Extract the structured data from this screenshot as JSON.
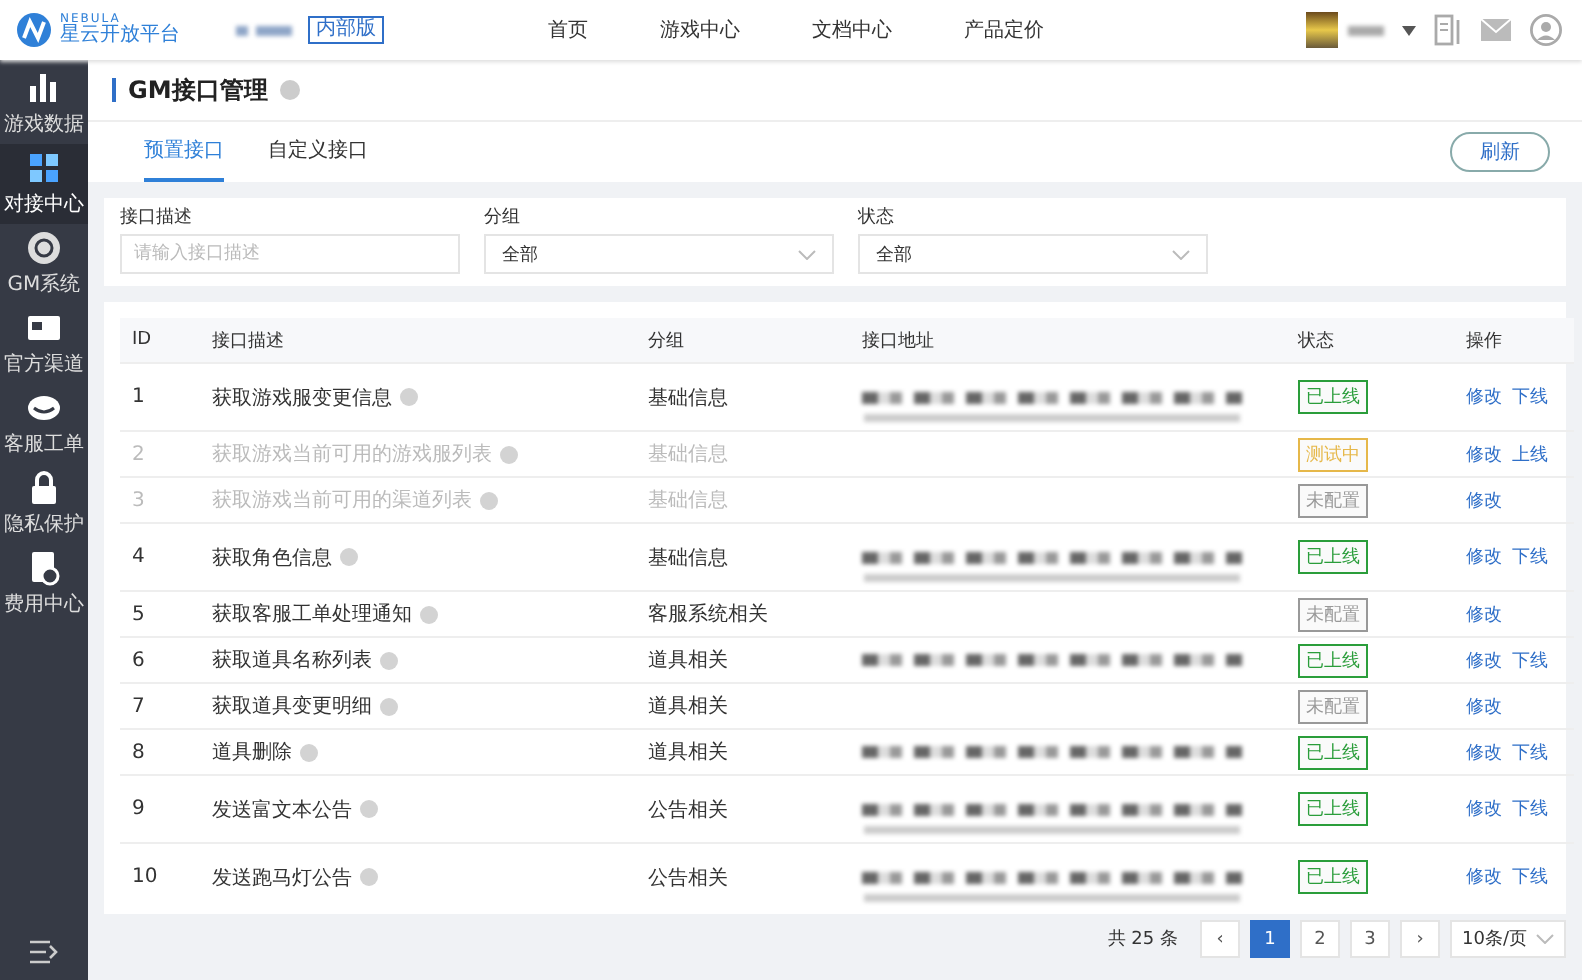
{
  "topbar": {
    "logo_word": "NEBULA",
    "logo_name": "星云开放平台",
    "edition_badge": "内部版",
    "nav": [
      {
        "label": "首页",
        "selected": false
      },
      {
        "label": "游戏中心",
        "selected": false
      },
      {
        "label": "文档中心",
        "selected": false
      },
      {
        "label": "产品定价",
        "selected": false
      }
    ]
  },
  "sidebar": {
    "items": [
      {
        "label": "游戏数据",
        "selected": false
      },
      {
        "label": "对接中心",
        "selected": true
      },
      {
        "label": "GM系统",
        "selected": false
      },
      {
        "label": "官方渠道",
        "selected": false
      },
      {
        "label": "客服工单",
        "selected": false
      },
      {
        "label": "隐私保护",
        "selected": false
      },
      {
        "label": "费用中心",
        "selected": false
      }
    ]
  },
  "page": {
    "title": "GM接口管理",
    "tabs": [
      {
        "label": "预置接口",
        "selected": true
      },
      {
        "label": "自定义接口",
        "selected": false
      }
    ],
    "refresh_button": "刷新"
  },
  "filters": [
    {
      "label": "接口描述",
      "kind": "input",
      "placeholder": "请输入接口描述"
    },
    {
      "label": "分组",
      "kind": "select",
      "value": "全部"
    },
    {
      "label": "状态",
      "kind": "select",
      "value": "全部"
    }
  ],
  "table": {
    "columns": [
      "ID",
      "接口描述",
      "分组",
      "接口地址",
      "状态",
      "操作"
    ],
    "rows": [
      {
        "kind": "long-address",
        "id": "1",
        "description": "获取游戏服变更信息",
        "group": "基础信息",
        "status": {
          "label": "已上线",
          "color": "#2a9d3a"
        },
        "disabled": false,
        "actions": [
          "修改",
          "下线"
        ]
      },
      {
        "kind": "no-address",
        "id": "2",
        "description": "获取游戏当前可用的游戏服列表",
        "group": "基础信息",
        "status": {
          "label": "测试中",
          "color": "#e6b84a"
        },
        "disabled": true,
        "actions": [
          "修改",
          "上线"
        ]
      },
      {
        "kind": "no-address",
        "id": "3",
        "description": "获取游戏当前可用的渠道列表",
        "group": "基础信息",
        "status": {
          "label": "未配置",
          "color": "#999999"
        },
        "disabled": true,
        "actions": [
          "修改"
        ]
      },
      {
        "kind": "long-address",
        "id": "4",
        "description": "获取角色信息",
        "group": "基础信息",
        "status": {
          "label": "已上线",
          "color": "#2a9d3a"
        },
        "disabled": false,
        "actions": [
          "修改",
          "下线"
        ]
      },
      {
        "kind": "no-address",
        "id": "5",
        "description": "获取客服工单处理通知",
        "group": "客服系统相关",
        "status": {
          "label": "未配置",
          "color": "#999999"
        },
        "disabled": false,
        "actions": [
          "修改"
        ]
      },
      {
        "kind": "short-address",
        "id": "6",
        "description": "获取道具名称列表",
        "group": "道具相关",
        "status": {
          "label": "已上线",
          "color": "#2a9d3a"
        },
        "disabled": false,
        "actions": [
          "修改",
          "下线"
        ]
      },
      {
        "kind": "no-address",
        "id": "7",
        "description": "获取道具变更明细",
        "group": "道具相关",
        "status": {
          "label": "未配置",
          "color": "#999999"
        },
        "disabled": false,
        "actions": [
          "修改"
        ]
      },
      {
        "kind": "short-address",
        "id": "8",
        "description": "道具删除",
        "group": "道具相关",
        "status": {
          "label": "已上线",
          "color": "#2a9d3a"
        },
        "disabled": false,
        "actions": [
          "修改",
          "下线"
        ]
      },
      {
        "kind": "long-address",
        "id": "9",
        "description": "发送富文本公告",
        "group": "公告相关",
        "status": {
          "label": "已上线",
          "color": "#2a9d3a"
        },
        "disabled": false,
        "actions": [
          "修改",
          "下线"
        ]
      },
      {
        "kind": "long-address",
        "id": "10",
        "description": "发送跑马灯公告",
        "group": "公告相关",
        "status": {
          "label": "已上线",
          "color": "#2a9d3a"
        },
        "disabled": false,
        "actions": [
          "修改",
          "下线"
        ]
      }
    ]
  },
  "pagination": {
    "total": "共 25 条",
    "prev": "‹",
    "pages": [
      {
        "label": "1",
        "selected": true
      },
      {
        "label": "2",
        "selected": false
      },
      {
        "label": "3",
        "selected": false
      }
    ],
    "next": "›",
    "page_size": "10条/页"
  }
}
